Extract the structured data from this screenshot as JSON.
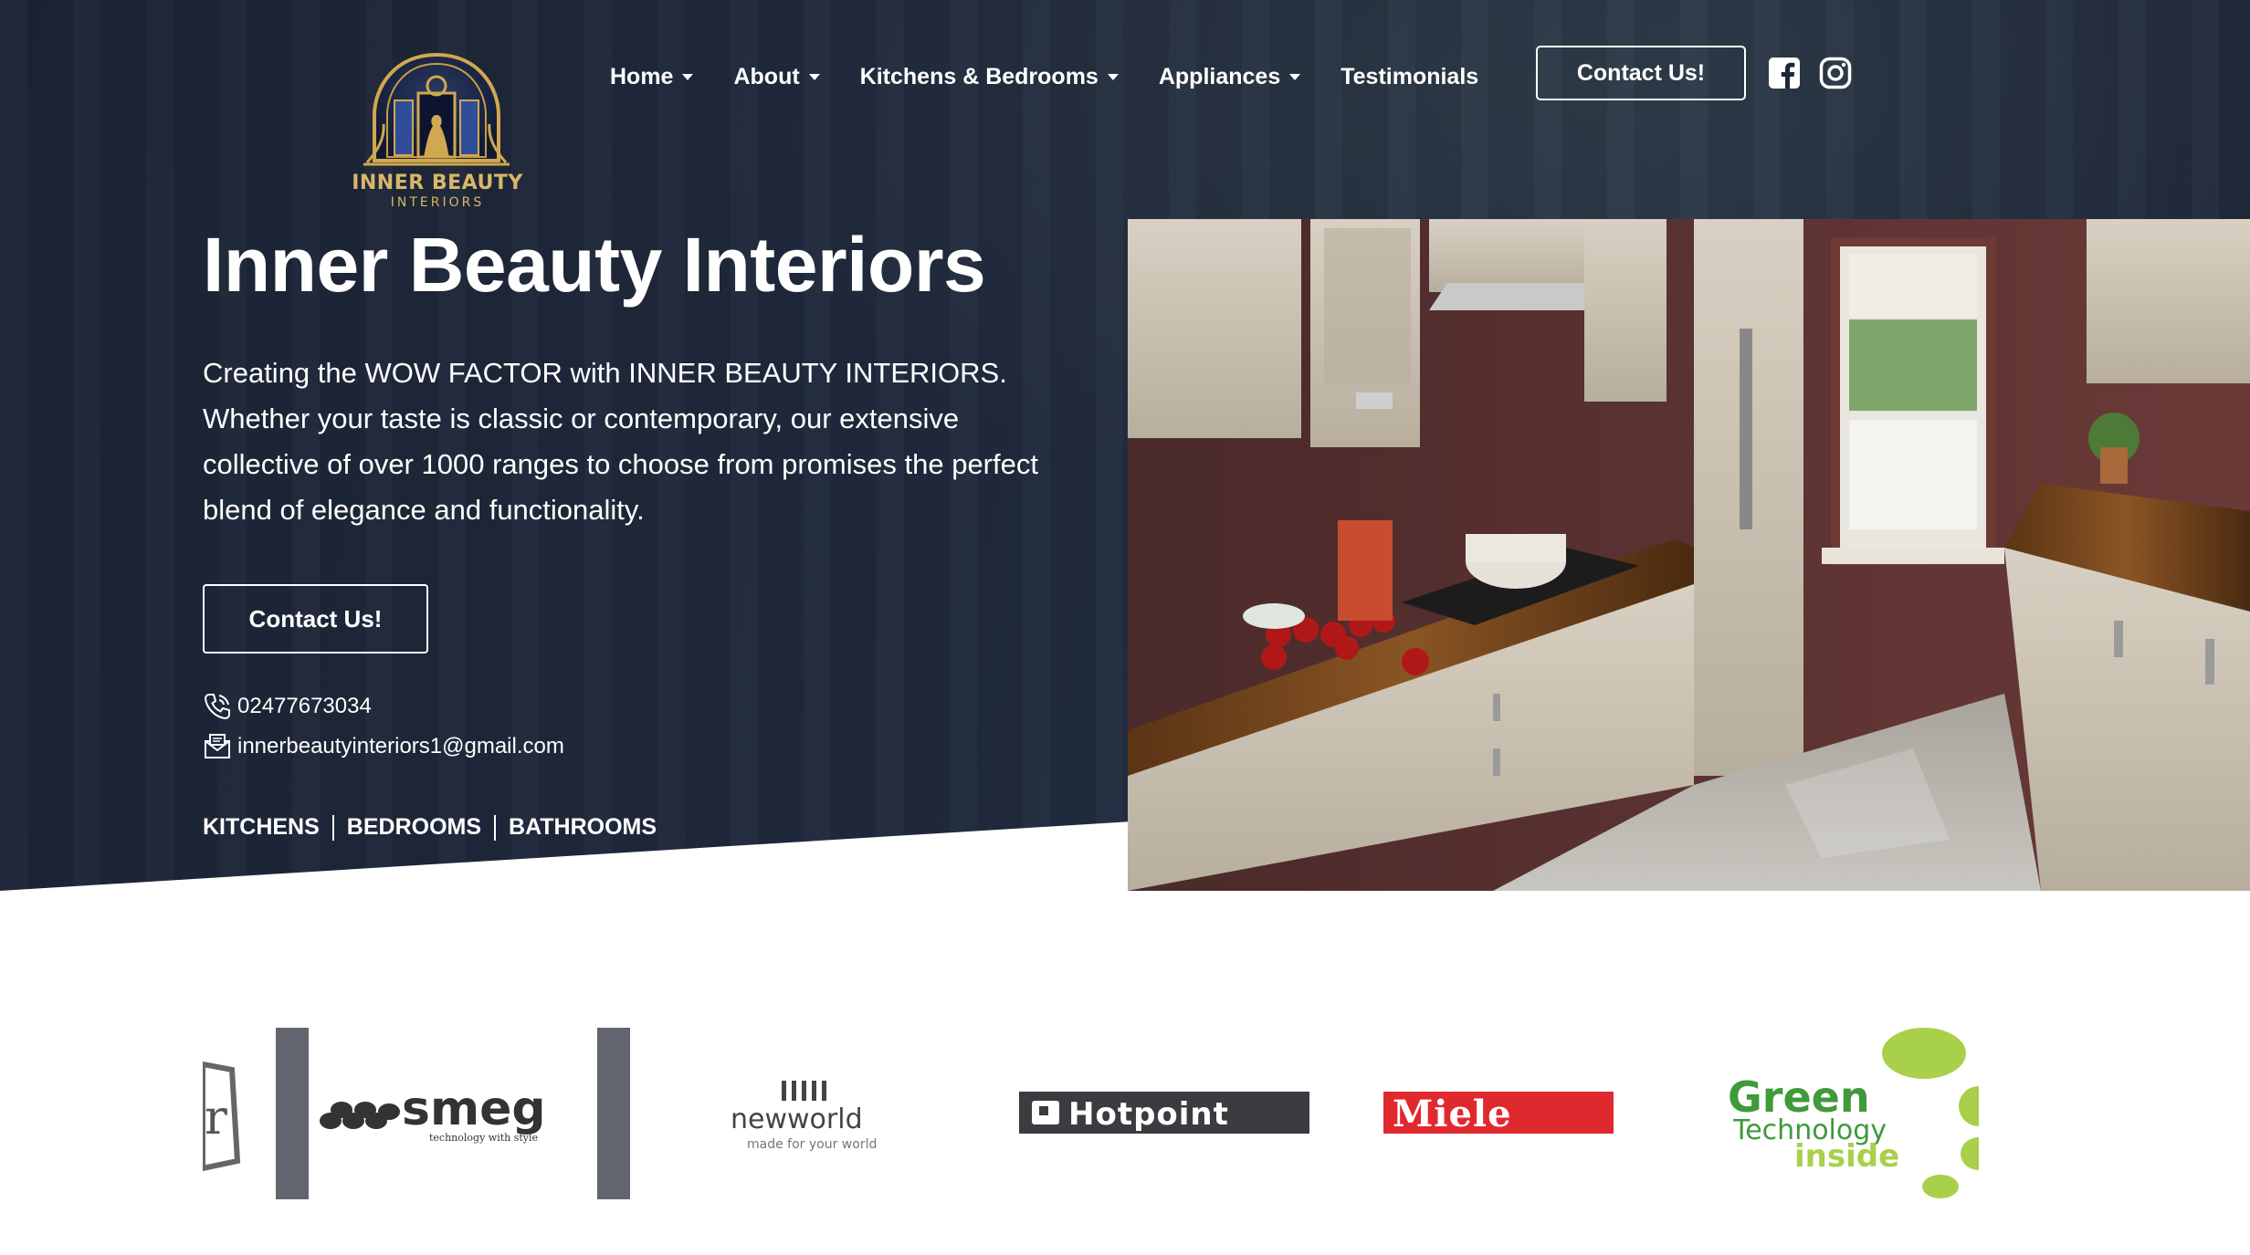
{
  "brand": {
    "logo_line1": "INNER BEAUTY",
    "logo_line2": "INTERIORS"
  },
  "nav": {
    "items": [
      {
        "label": "Home",
        "dropdown": true
      },
      {
        "label": "About",
        "dropdown": true
      },
      {
        "label": "Kitchens & Bedrooms",
        "dropdown": true
      },
      {
        "label": "Appliances",
        "dropdown": true
      },
      {
        "label": "Testimonials",
        "dropdown": false
      }
    ],
    "contact_label": "Contact Us!",
    "social": [
      "facebook-icon",
      "instagram-icon"
    ]
  },
  "hero": {
    "title": "Inner Beauty Interiors",
    "description": "Creating the WOW FACTOR with INNER BEAUTY INTERIORS. Whether your taste is classic or contemporary, our extensive collective of over 1000 ranges to choose from promises the perfect blend of elegance and functionality.",
    "cta_label": "Contact Us!",
    "phone": "02477673034",
    "email": "innerbeautyinteriors1@gmail.com",
    "services": [
      "KITCHENS",
      "BEDROOMS",
      "BATHROOMS"
    ]
  },
  "brands": {
    "logos": [
      {
        "name": "partial-logo",
        "text": "r"
      },
      {
        "name": "smeg",
        "text": "smeg",
        "tagline": "technology with style"
      },
      {
        "name": "newworld",
        "text": "newworld",
        "tagline": "made for your world"
      },
      {
        "name": "hotpoint",
        "text": "Hotpoint"
      },
      {
        "name": "miele",
        "text": "Miele"
      },
      {
        "name": "green-technology",
        "text1": "Green",
        "text2": "Technology",
        "text3": "inside"
      }
    ]
  },
  "colors": {
    "hero_bg": "#1f283a",
    "miele_red": "#e0292f",
    "green_tech": "#3f9a3a",
    "green_tech_dots": "#a8d04a",
    "hotpoint_bg": "#3b3c40"
  }
}
